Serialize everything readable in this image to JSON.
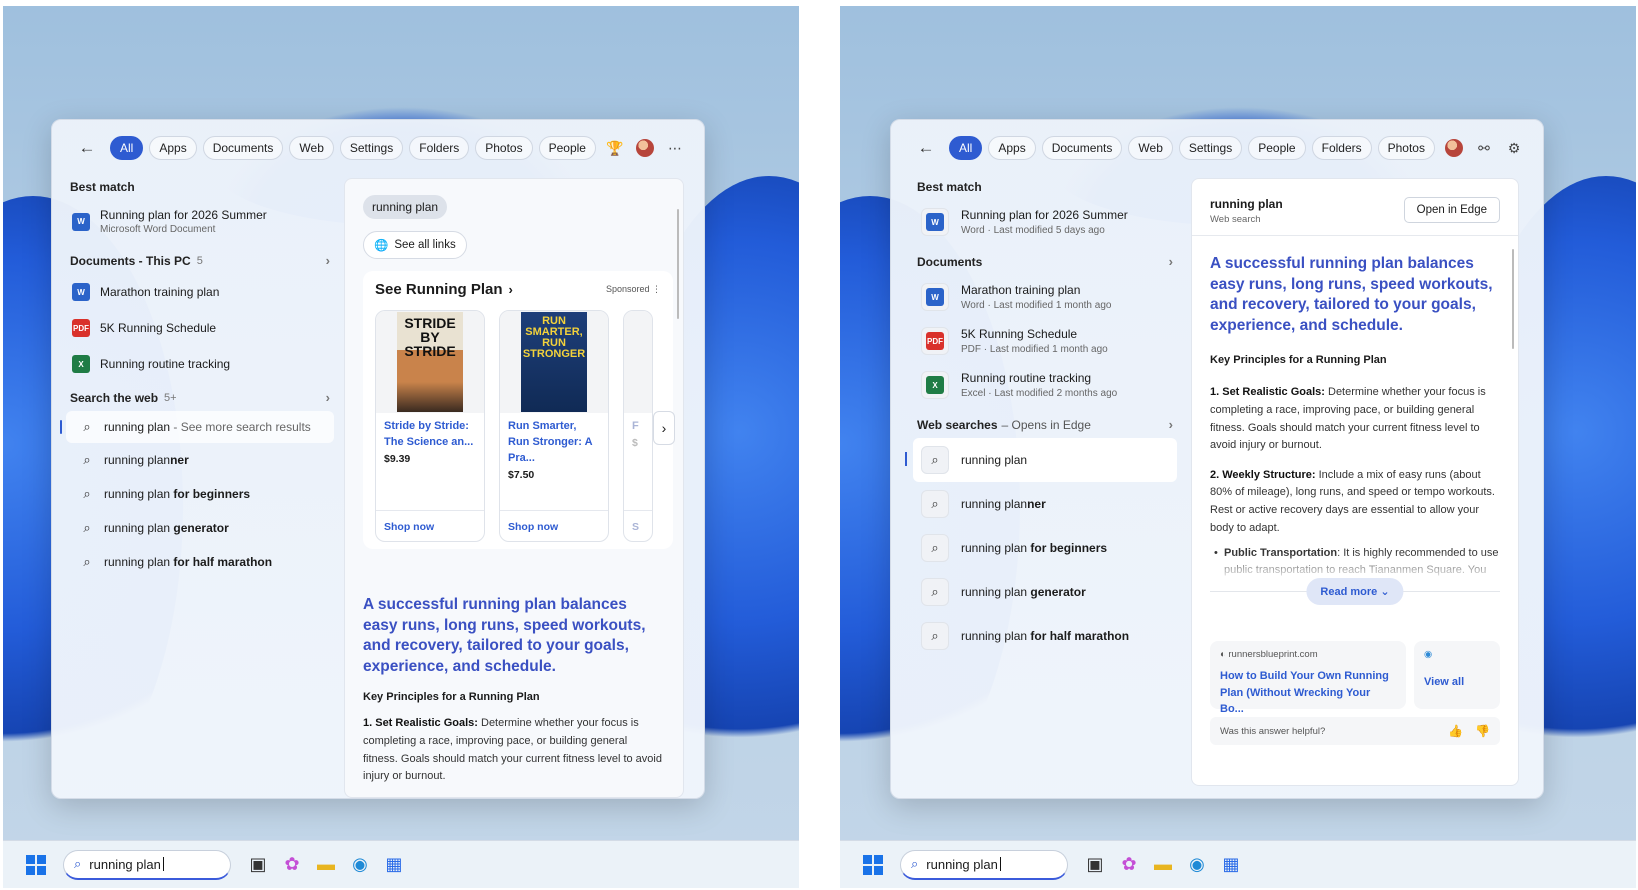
{
  "taskbar": {
    "query": "running plan"
  },
  "left": {
    "filters": [
      "All",
      "Apps",
      "Documents",
      "Web",
      "Settings",
      "Folders",
      "Photos",
      "People"
    ],
    "best_match_heading": "Best match",
    "best_match": {
      "title": "Running plan for 2026 Summer",
      "subtitle": "Microsoft Word Document"
    },
    "documents_heading": "Documents - This PC",
    "documents_count": "5",
    "documents": [
      {
        "title": "Marathon training plan",
        "type": "word"
      },
      {
        "title": "5K Running Schedule",
        "type": "pdf"
      },
      {
        "title": "Running routine tracking",
        "type": "excel"
      }
    ],
    "web_heading": "Search the web",
    "web_count": "5+",
    "web_first": {
      "query": "running plan",
      "suffix": " - See more search results"
    },
    "suggestions": [
      {
        "base": "running plan",
        "bold": "ner"
      },
      {
        "base": "running plan ",
        "bold": "for beginners"
      },
      {
        "base": "running plan ",
        "bold": "generator"
      },
      {
        "base": "running plan ",
        "bold": "for half marathon"
      }
    ],
    "preview": {
      "query_chip": "running plan",
      "see_all": "See all links",
      "ads_title": "See Running Plan",
      "sponsored": "Sponsored",
      "products": [
        {
          "cover": "STRIDE BY STRIDE",
          "title": "Stride by Stride: The Science an...",
          "price": "$9.39",
          "cta": "Shop now"
        },
        {
          "cover": "RUN SMARTER, RUN STRONGER",
          "title": "Run Smarter, Run Stronger: A Pra...",
          "price": "$7.50",
          "cta": "Shop now"
        }
      ],
      "peek_card": {
        "title_fragment": "F",
        "price_fragment": "$",
        "cta_fragment": "S"
      },
      "answer": "A successful running plan balances easy runs, long runs, speed workouts, and recovery, tailored to your goals, experience, and schedule.",
      "key_title": "Key Principles for a Running Plan",
      "p1_bold": "1. Set Realistic Goals:",
      "p1_text": " Determine whether your focus is completing a race, improving pace, or building general fitness. Goals should match your current fitness level to avoid injury or burnout."
    }
  },
  "right": {
    "filters": [
      "All",
      "Apps",
      "Documents",
      "Web",
      "Settings",
      "People",
      "Folders",
      "Photos"
    ],
    "best_match_heading": "Best match",
    "best_match": {
      "title": "Running plan for 2026 Summer",
      "subtitle": "Word · Last modified 5 days ago"
    },
    "documents_heading": "Documents",
    "documents": [
      {
        "title": "Marathon training plan",
        "subtitle": "Word · Last modified 1 month ago",
        "type": "word"
      },
      {
        "title": "5K Running Schedule",
        "subtitle": "PDF · Last modified 1 month ago",
        "type": "pdf"
      },
      {
        "title": "Running routine tracking",
        "subtitle": "Excel · Last modified 2 months ago",
        "type": "excel"
      }
    ],
    "web_heading": "Web searches",
    "web_sub": "– Opens in Edge",
    "searches": [
      {
        "base": "running plan",
        "bold": ""
      },
      {
        "base": "running plan",
        "bold": "ner"
      },
      {
        "base": "running plan ",
        "bold": "for beginners"
      },
      {
        "base": "running plan ",
        "bold": "generator"
      },
      {
        "base": "running plan ",
        "bold": "for half marathon"
      }
    ],
    "preview": {
      "title": "running plan",
      "subtitle": "Web search",
      "open_edge": "Open in Edge",
      "answer": "A successful running plan balances easy runs, long runs, speed workouts, and recovery, tailored to your goals, experience, and schedule.",
      "key_title": "Key Principles for a Running Plan",
      "p1_bold": "1. Set Realistic Goals:",
      "p1_text": " Determine whether your focus is completing a race, improving pace, or building general fitness. Goals should match your current fitness level to avoid injury or burnout.",
      "p2_bold": "2. Weekly Structure:",
      "p2_text": " Include a mix of easy runs (about 80% of mileage), long runs, and speed or tempo workouts. Rest or active recovery days are essential to allow your body to adapt.",
      "bullet_bold": "Public Transportation",
      "bullet_text": ": It is highly recommended to use public transportation to reach Tiananmen Square. You",
      "read_more": "Read more",
      "source_domain": "runnersblueprint.com",
      "source_link": "How to Build Your Own Running Plan (Without Wrecking Your Bo...",
      "view_all": "View all",
      "feedback": "Was this answer helpful?"
    }
  }
}
